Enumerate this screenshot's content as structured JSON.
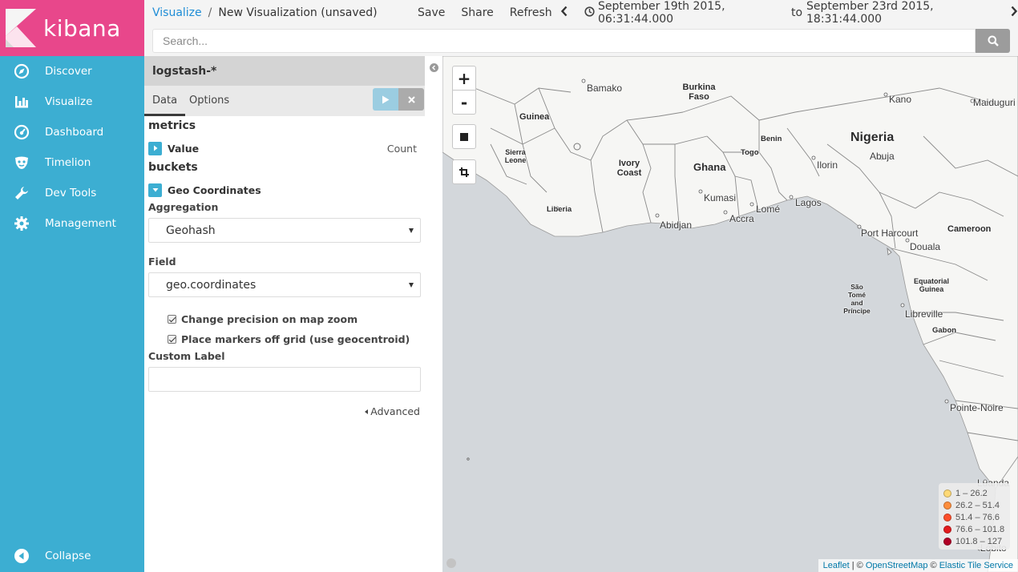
{
  "brand": {
    "name": "kibana",
    "color_logo_bg": "#e8478b",
    "color_sidebar": "#3caed2"
  },
  "sidebar": {
    "items": [
      {
        "label": "Discover",
        "icon": "compass-icon"
      },
      {
        "label": "Visualize",
        "icon": "bar-chart-icon"
      },
      {
        "label": "Dashboard",
        "icon": "dashboard-gauge-icon"
      },
      {
        "label": "Timelion",
        "icon": "timelion-mask-icon"
      },
      {
        "label": "Dev Tools",
        "icon": "wrench-icon"
      },
      {
        "label": "Management",
        "icon": "gear-icon"
      }
    ],
    "collapse_label": "Collapse"
  },
  "breadcrumb": {
    "parent": "Visualize",
    "separator": "/",
    "current": "New Visualization (unsaved)"
  },
  "topmenu": {
    "save": "Save",
    "share": "Share",
    "refresh": "Refresh"
  },
  "timepicker": {
    "from": "September 19th 2015, 06:31:44.000",
    "to_word": "to",
    "to": "September 23rd 2015, 18:31:44.000"
  },
  "search": {
    "placeholder": "Search...",
    "value": ""
  },
  "editor": {
    "index_pattern": "logstash-*",
    "tabs": [
      "Data",
      "Options"
    ],
    "active_tab": "Data",
    "metrics_title": "metrics",
    "metric": {
      "name": "Value",
      "desc": "Count"
    },
    "buckets_title": "buckets",
    "bucket": {
      "name": "Geo Coordinates"
    },
    "aggregation_label": "Aggregation",
    "aggregation_value": "Geohash",
    "field_label": "Field",
    "field_value": "geo.coordinates",
    "check_precision": "Change precision on map zoom",
    "check_geocentroid": "Place markers off grid (use geocentroid)",
    "custom_label_label": "Custom Label",
    "custom_label_value": "",
    "advanced_label": "Advanced"
  },
  "map": {
    "zoom_in": "+",
    "zoom_out": "-",
    "countries": [
      "Burkina Faso",
      "Guinea",
      "Sierra Leone",
      "Ivory Coast",
      "Ghana",
      "Togo",
      "Benin",
      "Nigeria",
      "Liberia",
      "Cameroon",
      "Equatorial Guinea",
      "Gabon",
      "São Tomé and Príncipe"
    ],
    "cities": [
      "Bamako",
      "Kano",
      "Maiduguri",
      "Ilorin",
      "Abuja",
      "Kumasi",
      "Lagos",
      "Lomé",
      "Accra",
      "Abidjan",
      "Port Harcourt",
      "Douala",
      "Libreville",
      "Pointe-Noire",
      "Luanda",
      "Lobito"
    ],
    "legend": [
      {
        "range": "1 – 26.2",
        "color": "#fed976"
      },
      {
        "range": "26.2 – 51.4",
        "color": "#fd8d3c"
      },
      {
        "range": "51.4 – 76.6",
        "color": "#fc4e2a"
      },
      {
        "range": "76.6 – 101.8",
        "color": "#e31a1c"
      },
      {
        "range": "101.8 – 127",
        "color": "#b10026"
      }
    ],
    "attribution": {
      "leaflet": "Leaflet",
      "sep1": " | © ",
      "osm": "OpenStreetMap",
      "sep2": " © ",
      "ets": "Elastic Tile Service"
    }
  }
}
